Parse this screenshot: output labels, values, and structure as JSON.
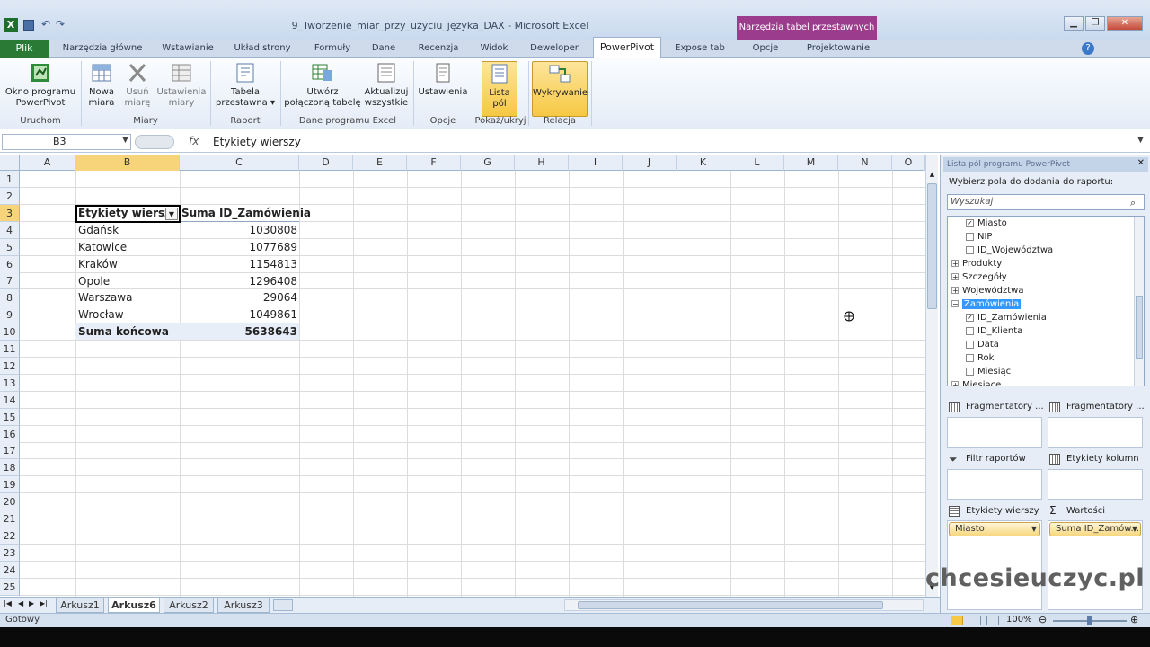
{
  "window": {
    "title": "9_Tworzenie_miar_przy_użyciu_języka_DAX - Microsoft Excel",
    "context_tab": "Narzędzia tabel przestawnych",
    "controls": [
      "▁",
      "❐",
      "✕"
    ]
  },
  "tabs": [
    "Plik",
    "Narzędzia główne",
    "Wstawianie",
    "Układ strony",
    "Formuły",
    "Dane",
    "Recenzja",
    "Widok",
    "Deweloper",
    "PowerPivot",
    "Expose tab",
    "Opcje",
    "Projektowanie"
  ],
  "ribbon": {
    "groups": [
      {
        "label": "Uruchom",
        "buttons": [
          {
            "label1": "Okno programu",
            "label2": "PowerPivot"
          }
        ]
      },
      {
        "label": "Miary",
        "buttons": [
          {
            "label1": "Nowa",
            "label2": "miara"
          },
          {
            "label1": "Usuń",
            "label2": "miarę"
          },
          {
            "label1": "Ustawienia",
            "label2": "miary"
          }
        ]
      },
      {
        "label": "Raport",
        "buttons": [
          {
            "label1": "Tabela",
            "label2": "przestawna ▾"
          }
        ]
      },
      {
        "label": "Dane programu Excel",
        "buttons": [
          {
            "label1": "Utwórz",
            "label2": "połączoną tabelę"
          },
          {
            "label1": "Aktualizuj",
            "label2": "wszystkie"
          }
        ]
      },
      {
        "label": "Opcje",
        "buttons": [
          {
            "label1": "Ustawienia",
            "label2": ""
          }
        ]
      },
      {
        "label": "Pokaż/ukryj",
        "buttons": [
          {
            "label1": "Lista",
            "label2": "pól"
          }
        ]
      },
      {
        "label": "Relacja",
        "buttons": [
          {
            "label1": "Wykrywanie",
            "label2": ""
          }
        ]
      }
    ]
  },
  "formula_bar": {
    "name_box": "B3",
    "fx": "fx",
    "content": "Etykiety wierszy"
  },
  "columns": [
    "A",
    "B",
    "C",
    "D",
    "E",
    "F",
    "G",
    "H",
    "I",
    "J",
    "K",
    "L",
    "M",
    "N",
    "O"
  ],
  "rows": [
    "1",
    "2",
    "3",
    "4",
    "5",
    "6",
    "7",
    "8",
    "9",
    "10",
    "11",
    "12",
    "13",
    "14",
    "15",
    "16",
    "17",
    "18",
    "19",
    "20",
    "21",
    "22",
    "23",
    "24",
    "25"
  ],
  "pivot": {
    "header_row_label": "Etykiety wierszy",
    "header_value": "Suma ID_Zamówienia",
    "rows": [
      {
        "label": "Gdańsk",
        "value": "1030808"
      },
      {
        "label": "Katowice",
        "value": "1077689"
      },
      {
        "label": "Kraków",
        "value": "1154813"
      },
      {
        "label": "Opole",
        "value": "1296408"
      },
      {
        "label": "Warszawa",
        "value": "29064"
      },
      {
        "label": "Wrocław",
        "value": "1049861"
      }
    ],
    "total_label": "Suma końcowa",
    "total_value": "5638643"
  },
  "sheets": [
    "Arkusz1",
    "Arkusz6",
    "Arkusz2",
    "Arkusz3"
  ],
  "active_sheet": "Arkusz6",
  "status_left": "Gotowy",
  "zoom": "100%",
  "field_list": {
    "header": "Lista pól programu PowerPivot",
    "instruction": "Wybierz pola do dodania do raportu:",
    "search_placeholder": "Wyszukaj",
    "items": [
      {
        "type": "field",
        "label": "Miasto",
        "checked": true
      },
      {
        "type": "field",
        "label": "NIP",
        "checked": false
      },
      {
        "type": "field",
        "label": "ID_Województwa",
        "checked": false
      },
      {
        "type": "table",
        "label": "Produkty",
        "expanded": false
      },
      {
        "type": "table",
        "label": "Szczegóły",
        "expanded": false
      },
      {
        "type": "table",
        "label": "Województwa",
        "expanded": false
      },
      {
        "type": "table",
        "label": "Zamówienia",
        "expanded": true,
        "selected": true
      },
      {
        "type": "field",
        "label": "ID_Zamówienia",
        "checked": true
      },
      {
        "type": "field",
        "label": "ID_Klienta",
        "checked": false
      },
      {
        "type": "field",
        "label": "Data",
        "checked": false
      },
      {
        "type": "field",
        "label": "Rok",
        "checked": false
      },
      {
        "type": "field",
        "label": "Miesiąc",
        "checked": false
      },
      {
        "type": "table",
        "label": "Miesiące",
        "expanded": false
      }
    ],
    "zones": {
      "slicers_v": "Fragmentatory ...",
      "slicers_h": "Fragmentatory ...",
      "report_filter": "Filtr raportów",
      "column_labels": "Etykiety kolumn",
      "row_labels": "Etykiety wierszy",
      "values": "Wartości",
      "row_field": "Miasto",
      "value_field": "Suma ID_Zamów..."
    }
  },
  "watermark": "chcesieuczyc.pl",
  "colors": {
    "plik": "#2a7a35",
    "context": "#9b3c8c",
    "highlight": "#f6c843",
    "selected_item": "#3399ff"
  }
}
